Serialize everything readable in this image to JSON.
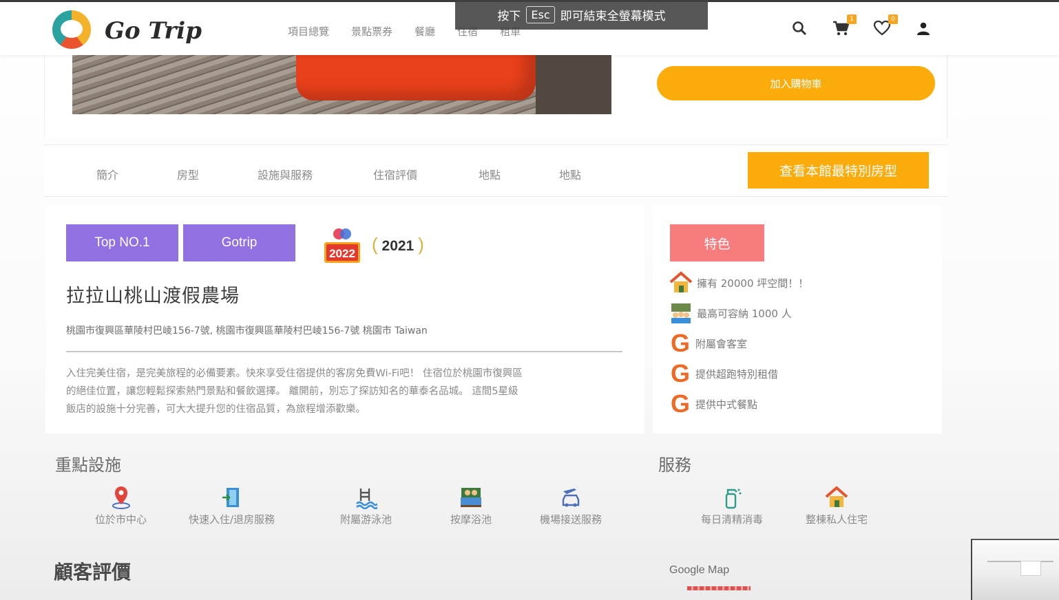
{
  "fullscreen_hint": {
    "prefix": "按下",
    "key": "Esc",
    "suffix": "即可結束全螢幕模式"
  },
  "nav": {
    "brand": "Go Trip",
    "links": [
      "項目總覽",
      "景點票券",
      "餐廳",
      "住宿",
      "租車"
    ],
    "cart_count": "1",
    "wishlist_count": "0"
  },
  "hero": {
    "add_to_cart": "加入購物車"
  },
  "tabs": {
    "items": [
      "簡介",
      "房型",
      "設施與服務",
      "住宿評價",
      "地點",
      "地點"
    ],
    "special_button": "查看本館最特別房型"
  },
  "detail": {
    "tags": [
      "Top NO.1",
      "Gotrip"
    ],
    "award_2022": "2022",
    "award_2021": "2021",
    "name": "拉拉山桃山渡假農場",
    "address": "桃園市復興區華陵村巴崚156-7號, 桃園市復興區華陵村巴崚156-7號 桃園市 Taiwan",
    "description": [
      "入住完美住宿，是完美旅程的必備要素。快來享受住宿提供的客房免費Wi-Fi吧！ 住宿位於桃園市復興區",
      "的絕佳位置，讓您輕鬆探索熱門景點和餐飲選擇。 離開前，別忘了探訪知名的華泰名品城。 這間5星級",
      "飯店的設施十分完善，可大大提升您的住宿品質，為旅程增添歡樂。"
    ]
  },
  "facilities": {
    "title": "重點設施",
    "items": [
      {
        "label": "位於市中心",
        "icon": "map-pin-icon"
      },
      {
        "label": "快速入住/退房服務",
        "icon": "door-icon"
      },
      {
        "label": "附屬游泳池",
        "icon": "pool-icon"
      },
      {
        "label": "按摩浴池",
        "icon": "hot-tub-icon"
      },
      {
        "label": "機場接送服務",
        "icon": "airport-car-icon"
      }
    ]
  },
  "reviews": {
    "title": "顧客評價"
  },
  "features": {
    "button": "特色",
    "items": [
      {
        "text": "擁有 20000 坪空間！！",
        "icon": "house-icon"
      },
      {
        "text": "最高可容納 1000 人",
        "icon": "crowd-icon"
      },
      {
        "text": "附屬會客室",
        "icon": "g-logo-icon"
      },
      {
        "text": "提供超跑特別租借",
        "icon": "g-logo-icon"
      },
      {
        "text": "提供中式餐點",
        "icon": "g-logo-icon"
      }
    ]
  },
  "services": {
    "title": "服務",
    "items": [
      {
        "label": "每日清精消毒",
        "icon": "spray-bottle-icon"
      },
      {
        "label": "整棟私人住宅",
        "icon": "private-house-icon"
      }
    ]
  },
  "map": {
    "label": "Google Map"
  },
  "colors": {
    "orange": "#fbab0a",
    "purple": "#9171e2",
    "coral": "#f77c7d"
  }
}
